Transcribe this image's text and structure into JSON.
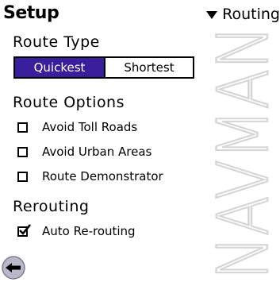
{
  "watermark_text": "NAVMAN",
  "header": {
    "title": "Setup",
    "menu_label": "Routing"
  },
  "route_type": {
    "title": "Route Type",
    "options": [
      "Quickest",
      "Shortest"
    ],
    "selected": "Quickest"
  },
  "route_options": {
    "title": "Route Options",
    "items": [
      {
        "label": "Avoid Toll Roads",
        "checked": false
      },
      {
        "label": "Avoid Urban Areas",
        "checked": false
      },
      {
        "label": "Route Demonstrator",
        "checked": false
      }
    ]
  },
  "rerouting": {
    "title": "Rerouting",
    "items": [
      {
        "label": "Auto Re-routing",
        "checked": true
      }
    ]
  },
  "colors": {
    "accent": "#3a1f9c",
    "watermark": "#e4e4e4",
    "back_button": "#b8b8c8"
  },
  "icons": {
    "back": "back-arrow-icon",
    "menu": "triangle-down-icon"
  }
}
